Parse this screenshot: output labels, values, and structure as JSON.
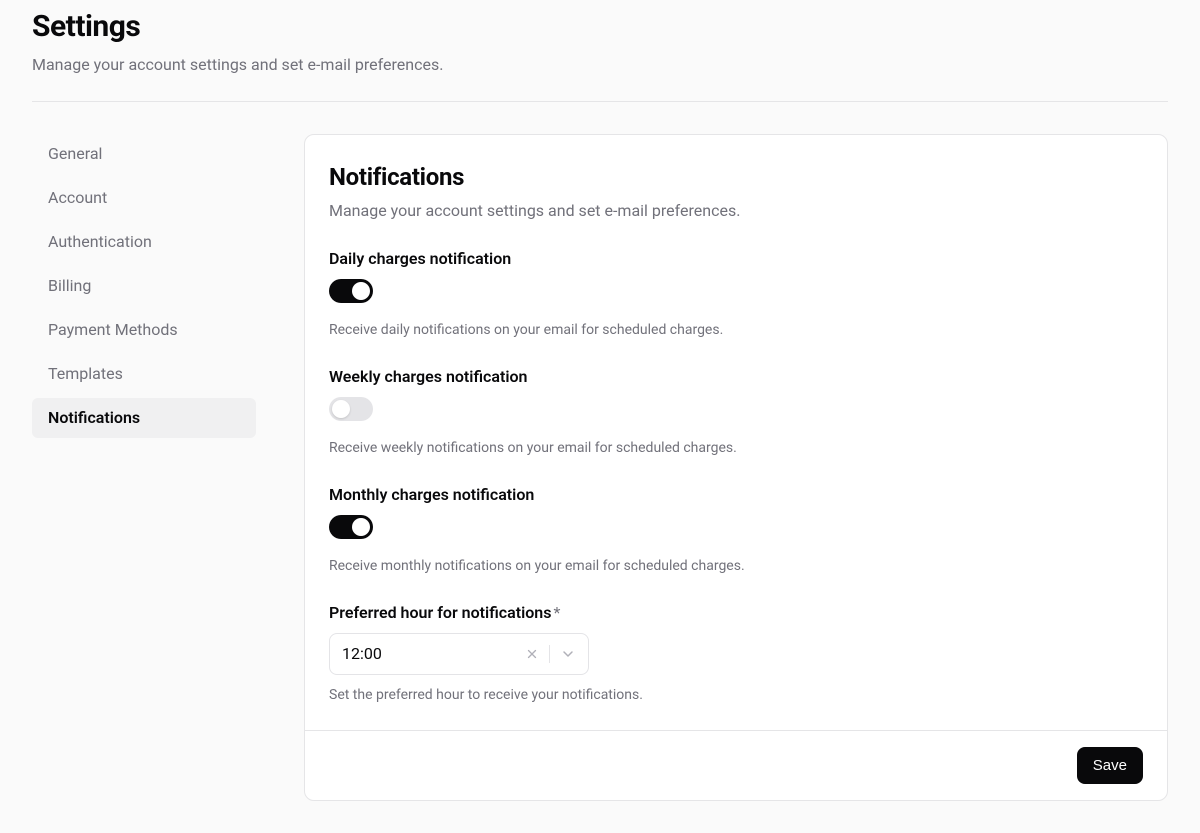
{
  "header": {
    "title": "Settings",
    "subtitle": "Manage your account settings and set e-mail preferences."
  },
  "sidebar": {
    "items": [
      {
        "label": "General",
        "active": false
      },
      {
        "label": "Account",
        "active": false
      },
      {
        "label": "Authentication",
        "active": false
      },
      {
        "label": "Billing",
        "active": false
      },
      {
        "label": "Payment Methods",
        "active": false
      },
      {
        "label": "Templates",
        "active": false
      },
      {
        "label": "Notifications",
        "active": true
      }
    ]
  },
  "panel": {
    "title": "Notifications",
    "subtitle": "Manage your account settings and set e-mail preferences.",
    "fields": {
      "daily": {
        "label": "Daily charges notification",
        "value": true,
        "help": "Receive daily notifications on your email for scheduled charges."
      },
      "weekly": {
        "label": "Weekly charges notification",
        "value": false,
        "help": "Receive weekly notifications on your email for scheduled charges."
      },
      "monthly": {
        "label": "Monthly charges notification",
        "value": true,
        "help": "Receive monthly notifications on your email for scheduled charges."
      },
      "hour": {
        "label": "Preferred hour for notifications",
        "required_mark": "*",
        "value": "12:00",
        "help": "Set the preferred hour to receive your notifications."
      }
    },
    "save_label": "Save"
  }
}
